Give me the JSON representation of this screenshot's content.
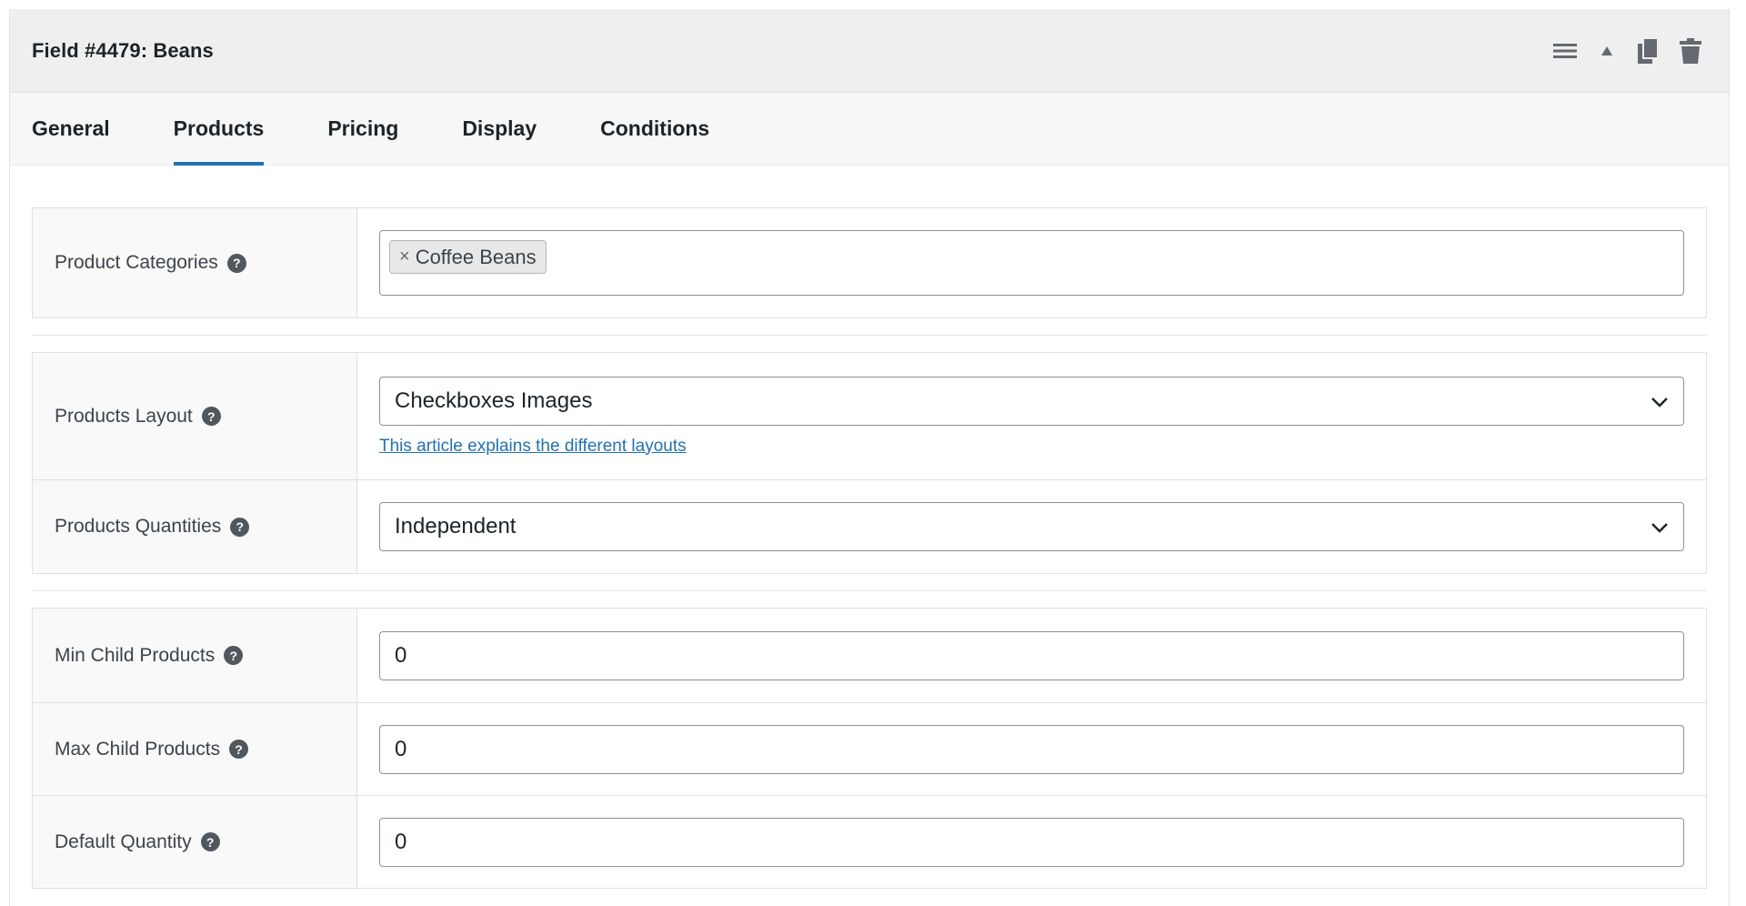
{
  "field": {
    "title": "Field #4479: Beans",
    "actions": [
      "menu-icon",
      "collapse-up-icon",
      "duplicate-icon",
      "trash-icon"
    ]
  },
  "tabs": [
    {
      "label": "General",
      "active": false
    },
    {
      "label": "Products",
      "active": true
    },
    {
      "label": "Pricing",
      "active": false
    },
    {
      "label": "Display",
      "active": false
    },
    {
      "label": "Conditions",
      "active": false
    }
  ],
  "product_categories": {
    "label": "Product Categories",
    "tags": [
      {
        "label": "Coffee Beans",
        "remove": "×"
      }
    ]
  },
  "products_layout": {
    "label": "Products Layout",
    "value": "Checkboxes Images",
    "help_link": "This article explains the different layouts"
  },
  "products_quantities": {
    "label": "Products Quantities",
    "value": "Independent"
  },
  "min_child_products": {
    "label": "Min Child Products",
    "value": "0"
  },
  "max_child_products": {
    "label": "Max Child Products",
    "value": "0"
  },
  "default_quantity": {
    "label": "Default Quantity",
    "value": "0"
  },
  "help_glyph": "?",
  "colors": {
    "accent": "#2271b1",
    "header_bg": "#efefef",
    "label_bg": "#f9f9f9"
  }
}
